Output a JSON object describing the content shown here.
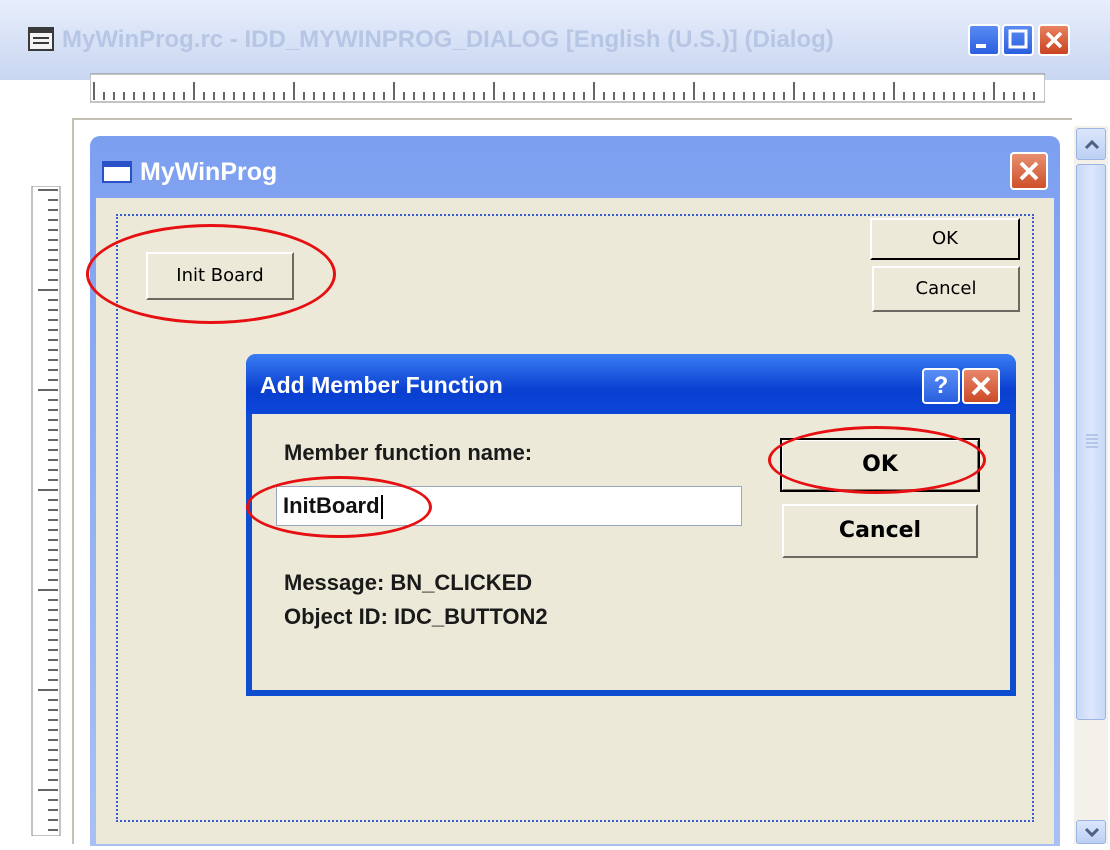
{
  "window": {
    "title": "MyWinProg.rc - IDD_MYWINPROG_DIALOG [English (U.S.)] (Dialog)",
    "controls": [
      "minimize-icon",
      "maximize-icon",
      "close-icon"
    ]
  },
  "designed_dialog": {
    "title": "MyWinProg",
    "init_button_label": "Init Board",
    "ok_label": "OK",
    "cancel_label": "Cancel"
  },
  "add_member_dialog": {
    "title": "Add Member Function",
    "help_glyph": "?",
    "field_label": "Member function name:",
    "field_value": "InitBoard",
    "ok_label": "OK",
    "cancel_label": "Cancel",
    "message_line": "Message: BN_CLICKED",
    "object_id_line": "Object ID: IDC_BUTTON2"
  },
  "colors": {
    "xp_blue": "#0a3fd0",
    "dialog_face": "#ece9d8",
    "annotation_red": "#e60f12"
  }
}
